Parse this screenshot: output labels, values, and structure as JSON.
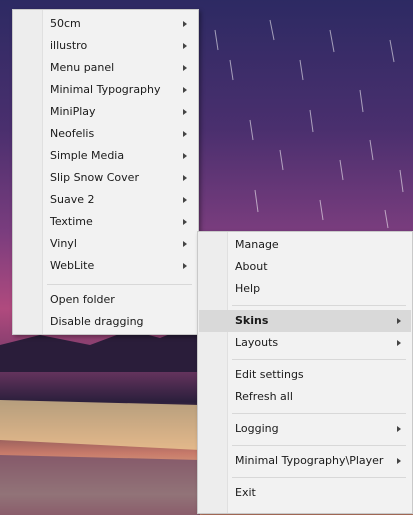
{
  "skins_submenu": {
    "items": [
      {
        "label": "50cm",
        "submenu": true
      },
      {
        "label": "illustro",
        "submenu": true
      },
      {
        "label": "Menu panel",
        "submenu": true
      },
      {
        "label": "Minimal Typography",
        "submenu": true
      },
      {
        "label": "MiniPlay",
        "submenu": true
      },
      {
        "label": "Neofelis",
        "submenu": true
      },
      {
        "label": "Simple Media",
        "submenu": true
      },
      {
        "label": "Slip Snow Cover",
        "submenu": true
      },
      {
        "label": "Suave 2",
        "submenu": true
      },
      {
        "label": "Textime",
        "submenu": true
      },
      {
        "label": "Vinyl",
        "submenu": true
      },
      {
        "label": "WebLite",
        "submenu": true
      }
    ],
    "open_folder": "Open folder",
    "disable_dragging": "Disable dragging"
  },
  "main_menu": {
    "manage": "Manage",
    "about": "About",
    "help": "Help",
    "skins": "Skins",
    "layouts": "Layouts",
    "edit_settings": "Edit settings",
    "refresh_all": "Refresh all",
    "logging": "Logging",
    "active_skin": "Minimal Typography\\Player",
    "exit": "Exit"
  }
}
